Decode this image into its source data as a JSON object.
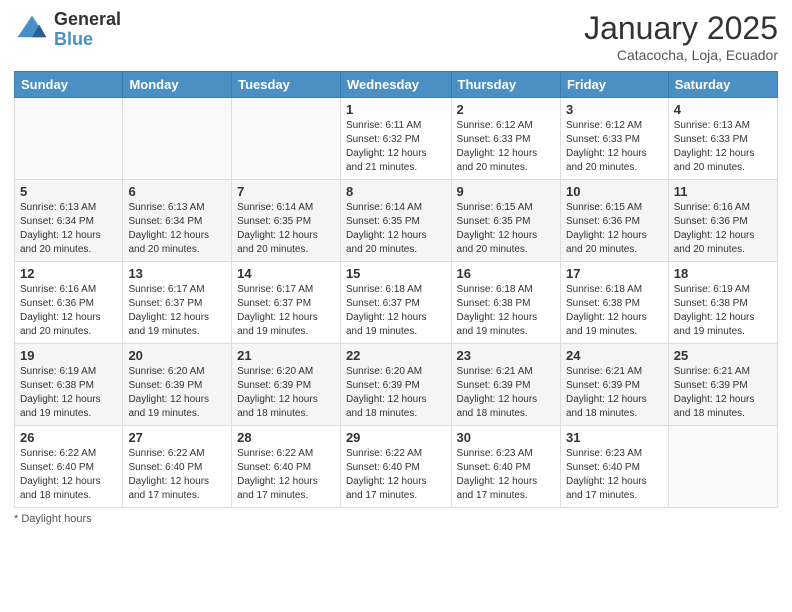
{
  "logo": {
    "general": "General",
    "blue": "Blue"
  },
  "title": "January 2025",
  "subtitle": "Catacocha, Loja, Ecuador",
  "days_of_week": [
    "Sunday",
    "Monday",
    "Tuesday",
    "Wednesday",
    "Thursday",
    "Friday",
    "Saturday"
  ],
  "footer": "Daylight hours",
  "weeks": [
    [
      {
        "day": "",
        "info": ""
      },
      {
        "day": "",
        "info": ""
      },
      {
        "day": "",
        "info": ""
      },
      {
        "day": "1",
        "info": "Sunrise: 6:11 AM\nSunset: 6:32 PM\nDaylight: 12 hours\nand 21 minutes."
      },
      {
        "day": "2",
        "info": "Sunrise: 6:12 AM\nSunset: 6:33 PM\nDaylight: 12 hours\nand 20 minutes."
      },
      {
        "day": "3",
        "info": "Sunrise: 6:12 AM\nSunset: 6:33 PM\nDaylight: 12 hours\nand 20 minutes."
      },
      {
        "day": "4",
        "info": "Sunrise: 6:13 AM\nSunset: 6:33 PM\nDaylight: 12 hours\nand 20 minutes."
      }
    ],
    [
      {
        "day": "5",
        "info": "Sunrise: 6:13 AM\nSunset: 6:34 PM\nDaylight: 12 hours\nand 20 minutes."
      },
      {
        "day": "6",
        "info": "Sunrise: 6:13 AM\nSunset: 6:34 PM\nDaylight: 12 hours\nand 20 minutes."
      },
      {
        "day": "7",
        "info": "Sunrise: 6:14 AM\nSunset: 6:35 PM\nDaylight: 12 hours\nand 20 minutes."
      },
      {
        "day": "8",
        "info": "Sunrise: 6:14 AM\nSunset: 6:35 PM\nDaylight: 12 hours\nand 20 minutes."
      },
      {
        "day": "9",
        "info": "Sunrise: 6:15 AM\nSunset: 6:35 PM\nDaylight: 12 hours\nand 20 minutes."
      },
      {
        "day": "10",
        "info": "Sunrise: 6:15 AM\nSunset: 6:36 PM\nDaylight: 12 hours\nand 20 minutes."
      },
      {
        "day": "11",
        "info": "Sunrise: 6:16 AM\nSunset: 6:36 PM\nDaylight: 12 hours\nand 20 minutes."
      }
    ],
    [
      {
        "day": "12",
        "info": "Sunrise: 6:16 AM\nSunset: 6:36 PM\nDaylight: 12 hours\nand 20 minutes."
      },
      {
        "day": "13",
        "info": "Sunrise: 6:17 AM\nSunset: 6:37 PM\nDaylight: 12 hours\nand 19 minutes."
      },
      {
        "day": "14",
        "info": "Sunrise: 6:17 AM\nSunset: 6:37 PM\nDaylight: 12 hours\nand 19 minutes."
      },
      {
        "day": "15",
        "info": "Sunrise: 6:18 AM\nSunset: 6:37 PM\nDaylight: 12 hours\nand 19 minutes."
      },
      {
        "day": "16",
        "info": "Sunrise: 6:18 AM\nSunset: 6:38 PM\nDaylight: 12 hours\nand 19 minutes."
      },
      {
        "day": "17",
        "info": "Sunrise: 6:18 AM\nSunset: 6:38 PM\nDaylight: 12 hours\nand 19 minutes."
      },
      {
        "day": "18",
        "info": "Sunrise: 6:19 AM\nSunset: 6:38 PM\nDaylight: 12 hours\nand 19 minutes."
      }
    ],
    [
      {
        "day": "19",
        "info": "Sunrise: 6:19 AM\nSunset: 6:38 PM\nDaylight: 12 hours\nand 19 minutes."
      },
      {
        "day": "20",
        "info": "Sunrise: 6:20 AM\nSunset: 6:39 PM\nDaylight: 12 hours\nand 19 minutes."
      },
      {
        "day": "21",
        "info": "Sunrise: 6:20 AM\nSunset: 6:39 PM\nDaylight: 12 hours\nand 18 minutes."
      },
      {
        "day": "22",
        "info": "Sunrise: 6:20 AM\nSunset: 6:39 PM\nDaylight: 12 hours\nand 18 minutes."
      },
      {
        "day": "23",
        "info": "Sunrise: 6:21 AM\nSunset: 6:39 PM\nDaylight: 12 hours\nand 18 minutes."
      },
      {
        "day": "24",
        "info": "Sunrise: 6:21 AM\nSunset: 6:39 PM\nDaylight: 12 hours\nand 18 minutes."
      },
      {
        "day": "25",
        "info": "Sunrise: 6:21 AM\nSunset: 6:39 PM\nDaylight: 12 hours\nand 18 minutes."
      }
    ],
    [
      {
        "day": "26",
        "info": "Sunrise: 6:22 AM\nSunset: 6:40 PM\nDaylight: 12 hours\nand 18 minutes."
      },
      {
        "day": "27",
        "info": "Sunrise: 6:22 AM\nSunset: 6:40 PM\nDaylight: 12 hours\nand 17 minutes."
      },
      {
        "day": "28",
        "info": "Sunrise: 6:22 AM\nSunset: 6:40 PM\nDaylight: 12 hours\nand 17 minutes."
      },
      {
        "day": "29",
        "info": "Sunrise: 6:22 AM\nSunset: 6:40 PM\nDaylight: 12 hours\nand 17 minutes."
      },
      {
        "day": "30",
        "info": "Sunrise: 6:23 AM\nSunset: 6:40 PM\nDaylight: 12 hours\nand 17 minutes."
      },
      {
        "day": "31",
        "info": "Sunrise: 6:23 AM\nSunset: 6:40 PM\nDaylight: 12 hours\nand 17 minutes."
      },
      {
        "day": "",
        "info": ""
      }
    ]
  ]
}
